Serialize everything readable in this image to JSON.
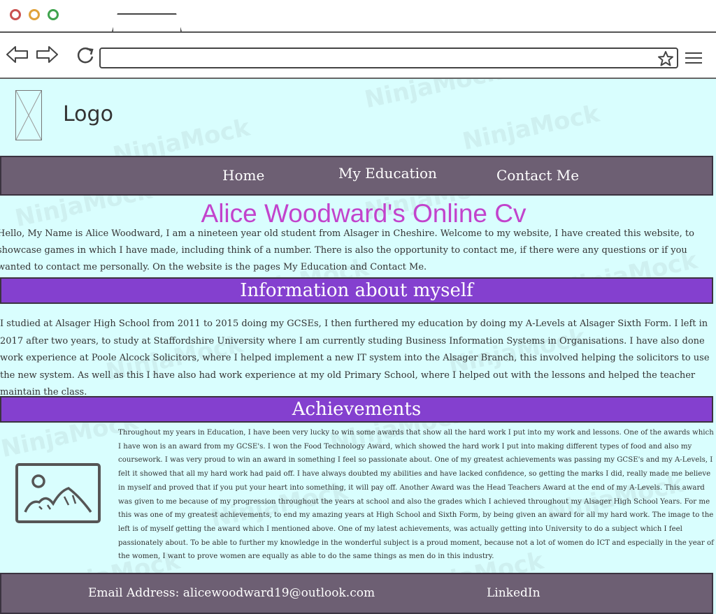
{
  "page": {
    "logo_label": "Logo",
    "menu": [
      "Home",
      "My Education",
      "Contact Me"
    ],
    "title": "Alice Woodward's Online Cv",
    "intro": "Hello, My Name is Alice Woodward, I am a nineteen year old student from Alsager in Cheshire. Welcome to my website, I have created this website, to showcase games in which I have made, including think of a number. There is also the opportunity to contact me, if there were any questions or if you wanted to contact me personally. On the website is the pages My Education and Contact Me.",
    "info_heading": "Information about myself",
    "info_text": "I studied at Alsager High School from 2011 to 2015 doing my GCSEs, I then furthered my education by doing my A-Levels at Alsager Sixth Form. I left in 2017 after two years, to study at Staffordshire University where I am currently studing Business Information Systems in Organisations. I have also done work experience at Poole Alcock Solicitors, where I helped implement a new IT system into the Alsager Branch, this involved helping the solicitors to use the new system. As well as this I have also had work experience at my old Primary School, where I helped out with the lessons and helped the teacher maintain the class.",
    "achievements_heading": "Achievements",
    "achievements_text": "Throughout my years in Education, I have been very lucky to win some awards that show all the hard work I put into my work and lessons.  One of the awards which I have won is an award from my GCSE's. I won the Food Technology Award, which showed the hard work I put into making different types of food and also my coursework. I was very proud to win an award in something I feel so passionate about.  One of my greatest achievements was passing my GCSE's and my A-Levels, I felt it showed that all my hard work had paid off. I have always doubted my abilities and have lacked confidence, so getting the marks I did, really made me believe in myself and proved that if you put your heart into something, it will pay off.  Another Award was the Head Teachers Award at the end of my A-Levels. This award was given to me because of my progression throughout the years at school and also the grades which I achieved throughout my Alsager High School Years. For me this was one of my greatest achievements, to end my amazing years at High School and Sixth Form, by being given an award for all my hard work. The image to the left is of myself getting the award which I mentioned above.  One of my latest achievements, was actually getting into University to do a subject which I feel passionately about. To be able to further my knowledge in the wonderful subject is a proud moment, because not a lot of women do ICT and especially in the year of the women, I want to prove women are equally as able to do the same things as men do in this industry.",
    "footer_email": "Email Address: alicewoodward19@outlook.com",
    "footer_linkedin": "LinkedIn"
  },
  "watermark": "NinjaMock",
  "colors": {
    "page_bg": "#d9fefe",
    "menu_bg": "#6d5f73",
    "band_bg": "#8440cf",
    "title": "#c243cc"
  },
  "icons": [
    "back-arrow-icon",
    "forward-arrow-icon",
    "reload-icon",
    "star-icon",
    "hamburger-menu-icon",
    "image-placeholder-icon"
  ]
}
